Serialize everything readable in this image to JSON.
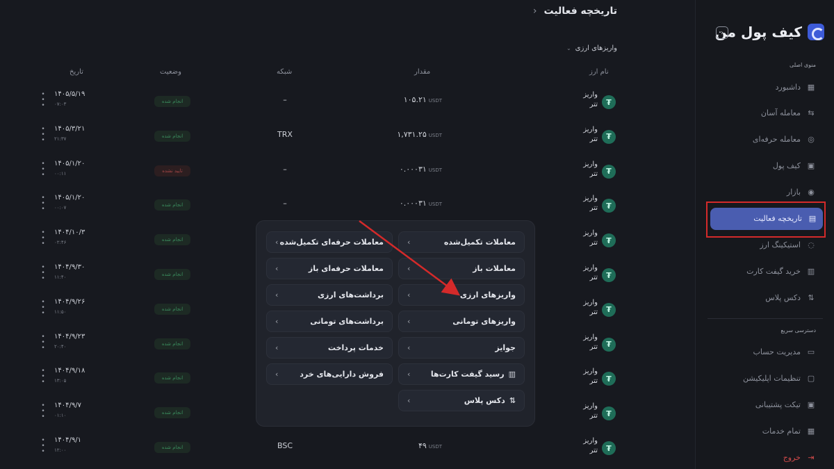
{
  "app": {
    "brand_name": "کیف پول من",
    "collapse_icon": "chevron-left-icon"
  },
  "sidebar": {
    "main_section_title": "منوی اصلی",
    "main_items": [
      {
        "label": "داشبورد",
        "icon": "grid-icon",
        "glyph": "▦"
      },
      {
        "label": "معامله آسان",
        "icon": "exchange-icon",
        "glyph": "⇆"
      },
      {
        "label": "معامله حرفه‌ای",
        "icon": "coins-icon",
        "glyph": "◎"
      },
      {
        "label": "کیف پول",
        "icon": "wallet-icon",
        "glyph": "▣"
      },
      {
        "label": "بازار",
        "icon": "market-icon",
        "glyph": "◉"
      },
      {
        "label": "تاریخچه فعالیت",
        "icon": "history-icon",
        "glyph": "▤",
        "active": true
      },
      {
        "label": "استیکینگ ارز",
        "icon": "staking-icon",
        "glyph": "◌"
      },
      {
        "label": "خرید گیفت کارت",
        "icon": "gift-icon",
        "glyph": "▥"
      },
      {
        "label": "دکس پلاس",
        "icon": "dex-icon",
        "glyph": "⇅"
      }
    ],
    "quick_section_title": "دسترسی سریع",
    "quick_items": [
      {
        "label": "مدیریت حساب",
        "icon": "account-icon",
        "glyph": "▭"
      },
      {
        "label": "تنظیمات اپلیکیشن",
        "icon": "settings-icon",
        "glyph": "▢"
      },
      {
        "label": "تیکت پشتیبانی",
        "icon": "ticket-icon",
        "glyph": "▣"
      },
      {
        "label": "تمام خدمات",
        "icon": "services-icon",
        "glyph": "▦"
      },
      {
        "label": "خروج",
        "icon": "logout-icon",
        "glyph": "⇥"
      }
    ]
  },
  "header": {
    "title": "تاریخچه فعالیت",
    "back_icon": "chevron-right-icon",
    "filter_label": "واریزهای ارزی"
  },
  "table": {
    "columns": {
      "coin": "نام ارز",
      "amount": "مقدار",
      "network": "شبکه",
      "status": "وضعیت",
      "date": "تاریخ"
    },
    "rows": [
      {
        "type": "واریز",
        "coin": "تتر",
        "amount": "۱۰۵.۲۱",
        "unit": "USDT",
        "network": "–",
        "status": "انجام شده",
        "failed": false,
        "date": "۱۴۰۵/۵/۱۹",
        "time": "۰۷:۰۳"
      },
      {
        "type": "واریز",
        "coin": "تتر",
        "amount": "۱,۷۳۱.۲۵",
        "unit": "USDT",
        "network": "TRX",
        "status": "انجام شده",
        "failed": false,
        "date": "۱۴۰۵/۳/۲۱",
        "time": "۲۱:۳۷"
      },
      {
        "type": "واریز",
        "coin": "تتر",
        "amount": "۰.۰۰۰۳۱",
        "unit": "USDT",
        "network": "–",
        "status": "تایید نشده",
        "failed": true,
        "date": "۱۴۰۵/۱/۲۰",
        "time": "۰۰:۱۱"
      },
      {
        "type": "واریز",
        "coin": "تتر",
        "amount": "۰.۰۰۰۳۱",
        "unit": "USDT",
        "network": "–",
        "status": "انجام شده",
        "failed": false,
        "date": "۱۴۰۵/۱/۲۰",
        "time": "۰۰:۰۷"
      },
      {
        "type": "واریز",
        "coin": "تتر",
        "amount": "",
        "unit": "",
        "network": "",
        "status": "انجام شده",
        "failed": false,
        "date": "۱۴۰۴/۱۰/۳",
        "time": "۰۲:۴۶"
      },
      {
        "type": "واریز",
        "coin": "تتر",
        "amount": "",
        "unit": "",
        "network": "",
        "status": "انجام شده",
        "failed": false,
        "date": "۱۴۰۴/۹/۳۰",
        "time": "۱۱:۴۰"
      },
      {
        "type": "واریز",
        "coin": "تتر",
        "amount": "",
        "unit": "",
        "network": "",
        "status": "انجام شده",
        "failed": false,
        "date": "۱۴۰۴/۹/۲۶",
        "time": "۱۱:۵۰"
      },
      {
        "type": "واریز",
        "coin": "تتر",
        "amount": "",
        "unit": "",
        "network": "",
        "status": "انجام شده",
        "failed": false,
        "date": "۱۴۰۴/۹/۲۳",
        "time": "۲۰:۴۰"
      },
      {
        "type": "واریز",
        "coin": "تتر",
        "amount": "",
        "unit": "",
        "network": "",
        "status": "انجام شده",
        "failed": false,
        "date": "۱۴۰۴/۹/۱۸",
        "time": "۱۳:۰۵"
      },
      {
        "type": "واریز",
        "coin": "تتر",
        "amount": "",
        "unit": "",
        "network": "",
        "status": "انجام شده",
        "failed": false,
        "date": "۱۴۰۴/۹/۷",
        "time": "۰۱:۱۰"
      },
      {
        "type": "واریز",
        "coin": "تتر",
        "amount": "۴۹",
        "unit": "USDT",
        "network": "BSC",
        "status": "انجام شده",
        "failed": false,
        "date": "۱۴۰۴/۹/۱",
        "time": "۱۲:۰۰"
      }
    ]
  },
  "popup": {
    "right_column": [
      {
        "label": "معاملات تکمیل‌شده",
        "icon": ""
      },
      {
        "label": "معاملات باز",
        "icon": ""
      },
      {
        "label": "واریزهای ارزی",
        "icon": ""
      },
      {
        "label": "واریزهای تومانی",
        "icon": ""
      },
      {
        "label": "جوایز",
        "icon": ""
      },
      {
        "label": "رسید گیفت کارت‌ها",
        "icon": "gift-box-icon",
        "glyph": "▥"
      },
      {
        "label": "دکس پلاس",
        "icon": "dex-icon",
        "glyph": "⇅"
      }
    ],
    "left_column": [
      {
        "label": "معاملات حرفه‌ای تکمیل‌شده"
      },
      {
        "label": "معاملات حرفه‌ای باز"
      },
      {
        "label": "برداشت‌های ارزی"
      },
      {
        "label": "برداشت‌های تومانی"
      },
      {
        "label": "خدمات پرداخت"
      },
      {
        "label": "فروش دارایی‌های خرد"
      }
    ]
  },
  "colors": {
    "accent": "#4a5db0",
    "annotation_red": "#d42a2a",
    "success": "#3b8d5e",
    "danger": "#a14545",
    "tether": "#1f6d58"
  }
}
